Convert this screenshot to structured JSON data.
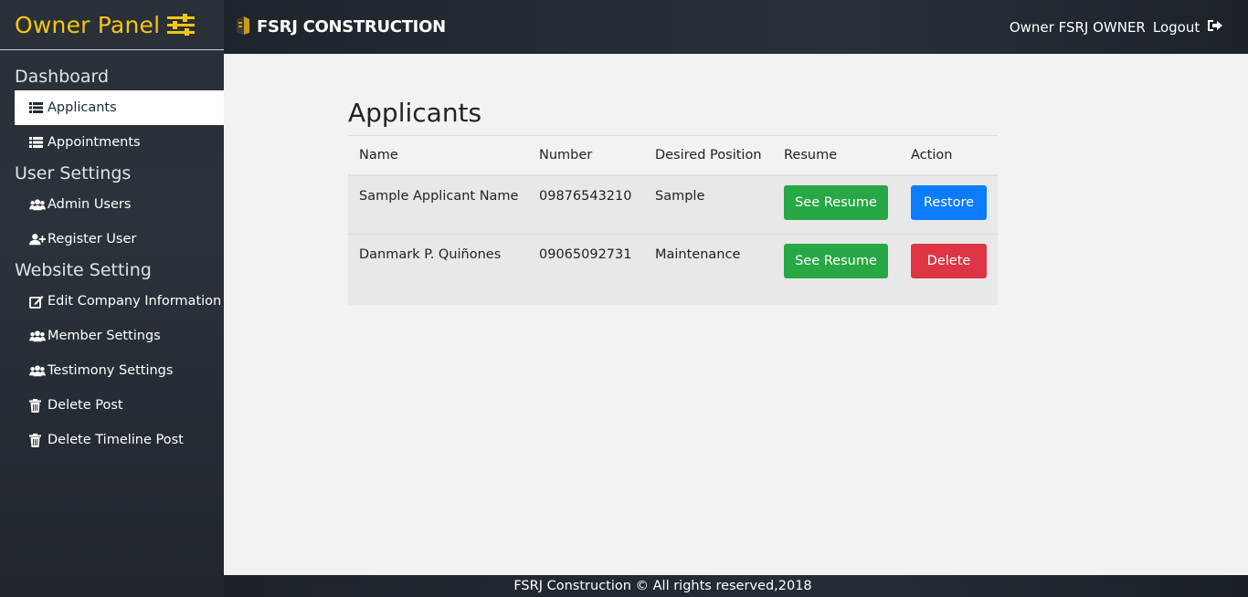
{
  "sidebar": {
    "brand": "Owner Panel",
    "sections": [
      {
        "title": "Dashboard"
      },
      {
        "title": "User Settings"
      },
      {
        "title": "Website Setting"
      }
    ],
    "items": [
      {
        "label": "Applicants",
        "icon": "list-icon"
      },
      {
        "label": "Appointments",
        "icon": "list-icon"
      },
      {
        "label": "Admin Users",
        "icon": "users-icon"
      },
      {
        "label": "Register User",
        "icon": "user-plus-icon"
      },
      {
        "label": "Edit Company Information",
        "icon": "edit-icon"
      },
      {
        "label": "Member Settings",
        "icon": "users-icon"
      },
      {
        "label": "Testimony Settings",
        "icon": "users-icon"
      },
      {
        "label": "Delete Post",
        "icon": "trash-icon"
      },
      {
        "label": "Delete Timeline Post",
        "icon": "trash-icon"
      }
    ]
  },
  "topbar": {
    "logo_text": "FSRJ CONSTRUCTION",
    "user_text": "Owner FSRJ OWNER",
    "logout_label": "Logout"
  },
  "main": {
    "title": "Applicants",
    "columns": [
      "Name",
      "Number",
      "Desired Position",
      "Resume",
      "Action"
    ],
    "rows": [
      {
        "name": "Sample Applicant Name",
        "number": "09876543210",
        "position": "Sample",
        "resume_label": "See Resume",
        "action_label": "Restore"
      },
      {
        "name": "Danmark P. Quiñones",
        "number": "09065092731",
        "position": "Maintenance",
        "resume_label": "See Resume",
        "action_label": "Delete"
      }
    ]
  },
  "footer": {
    "text": "FSRJ Construction © All rights reserved,2018"
  },
  "colors": {
    "brand_yellow": "#f3c612",
    "success_green": "#28a745",
    "primary_blue": "#0b7cff",
    "danger_red": "#dc3545"
  }
}
